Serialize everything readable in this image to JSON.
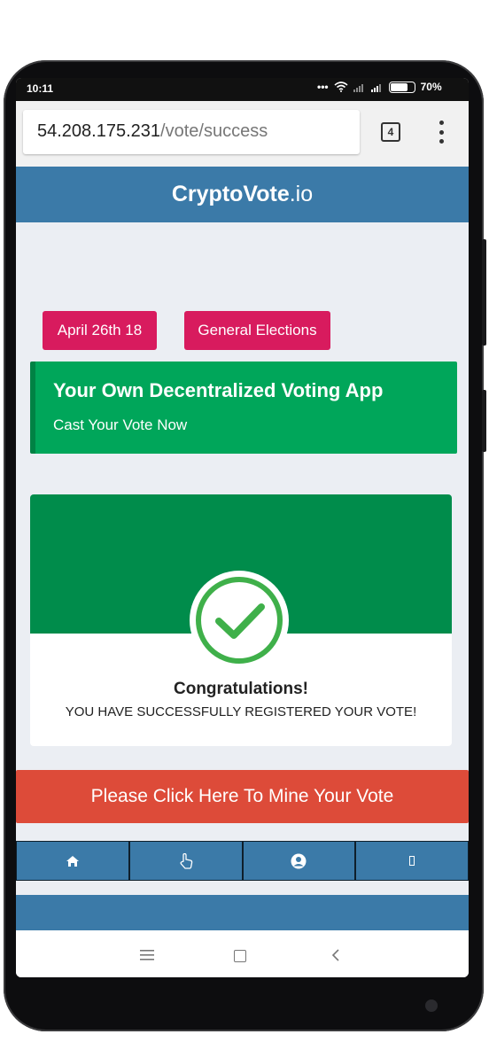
{
  "status": {
    "time": "10:11",
    "battery": "70%"
  },
  "browser": {
    "url_host": "54.208.175.231",
    "url_path": "/vote/success",
    "tab_count": "4"
  },
  "app": {
    "brand_main": "CryptoVote",
    "brand_suffix": ".io"
  },
  "tags": {
    "date": "April 26th 18",
    "election": "General Elections"
  },
  "banner": {
    "title": "Your Own Decentralized Voting App",
    "subtitle": "Cast Your Vote Now"
  },
  "success_card": {
    "heading": "Congratulations!",
    "message": "YOU HAVE SUCCESSFULLY REGISTERED YOUR VOTE!"
  },
  "mine_button": {
    "label": "Please Click Here To Mine Your Vote"
  },
  "bottom_nav": [
    {
      "icon": "home-icon"
    },
    {
      "icon": "pointer-hand-icon"
    },
    {
      "icon": "user-circle-icon"
    },
    {
      "icon": "unknown-glyph-icon"
    }
  ],
  "colors": {
    "appbar": "#3b7aa8",
    "pill": "#d81b5e",
    "banner": "#00a65a",
    "card_header": "#008c4b",
    "mine_button": "#dd4b39"
  }
}
